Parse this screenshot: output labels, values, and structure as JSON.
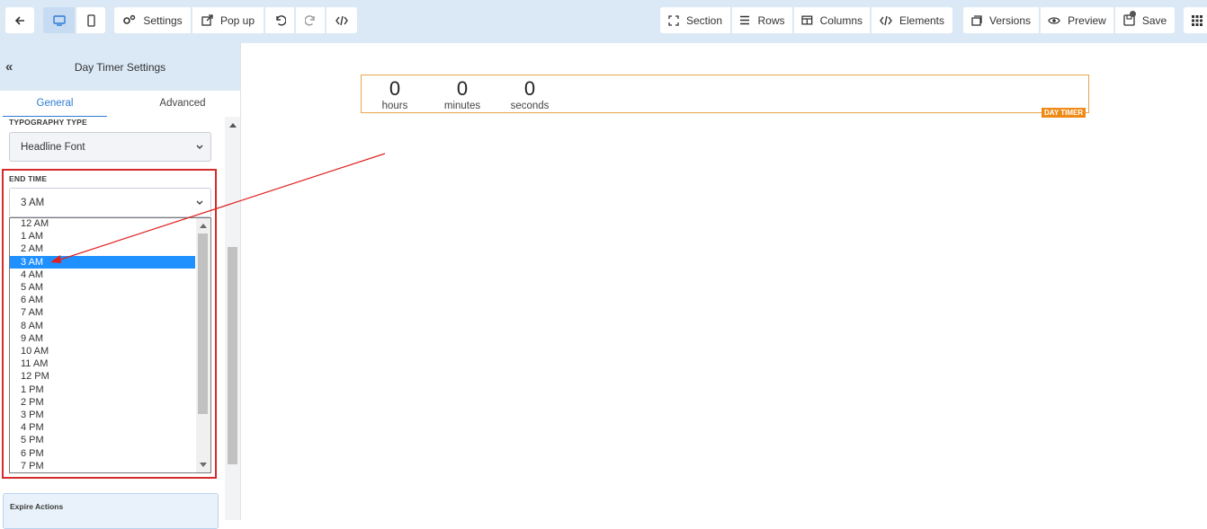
{
  "toolbar": {
    "settings": "Settings",
    "popup": "Pop up",
    "section": "Section",
    "rows": "Rows",
    "columns": "Columns",
    "elements": "Elements",
    "versions": "Versions",
    "preview": "Preview",
    "save": "Save"
  },
  "sidebar": {
    "title": "Day Timer Settings",
    "tabs": [
      "General",
      "Advanced"
    ],
    "typography_label": "TYPOGRAPHY TYPE",
    "typography_value": "Headline Font",
    "end_time_label": "END TIME",
    "end_time_value": "3 AM",
    "end_time_options": [
      "12 AM",
      "1 AM",
      "2 AM",
      "3 AM",
      "4 AM",
      "5 AM",
      "6 AM",
      "7 AM",
      "8 AM",
      "9 AM",
      "10 AM",
      "11 AM",
      "12 PM",
      "1 PM",
      "2 PM",
      "3 PM",
      "4 PM",
      "5 PM",
      "6 PM",
      "7 PM"
    ],
    "expire_label": "Expire Actions"
  },
  "timer": {
    "hours_value": "0",
    "hours_label": "hours",
    "minutes_value": "0",
    "minutes_label": "minutes",
    "seconds_value": "0",
    "seconds_label": "seconds",
    "badge": "DAY TIMER"
  },
  "colors": {
    "accent": "#2f7bd3",
    "highlight": "#d62b2b",
    "timer_border": "#e8a54b",
    "badge": "#f08a16",
    "selected": "#1e90ff"
  }
}
